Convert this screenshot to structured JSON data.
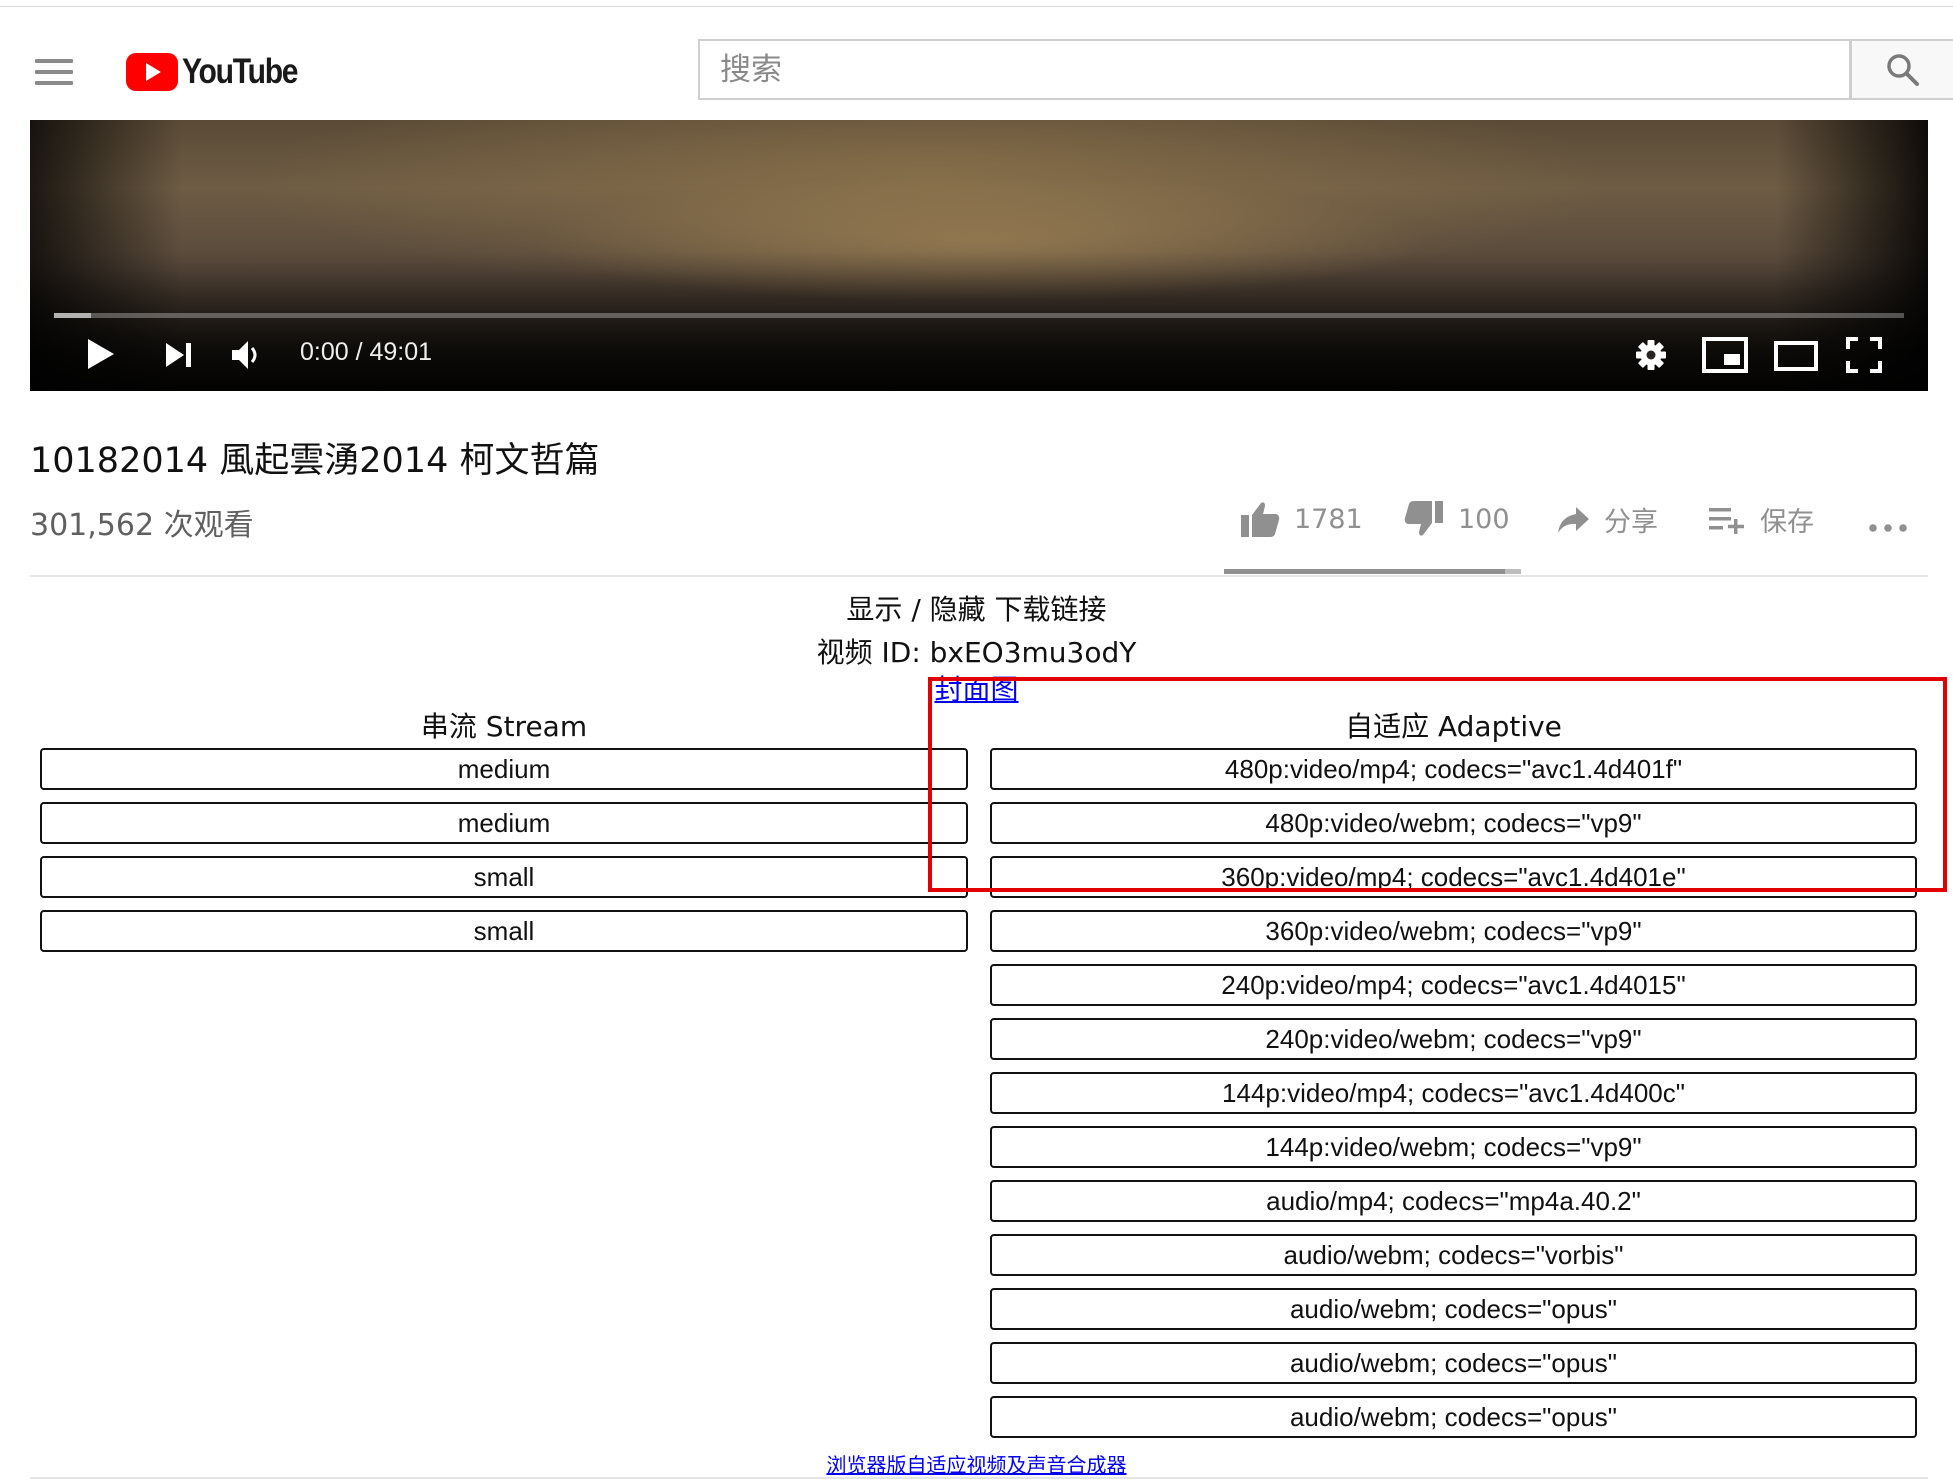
{
  "header": {
    "logo_text": "YouTube",
    "search_placeholder": "搜索"
  },
  "player": {
    "time": "0:00 / 49:01",
    "loaded_fraction": 0.02
  },
  "video": {
    "title": "10182014 風起雲湧2014 柯文哲篇",
    "views": "301,562 次观看",
    "likes": "1781",
    "dislikes": "100",
    "share_label": "分享",
    "save_label": "保存",
    "like_ratio": 0.947
  },
  "downloader": {
    "toggle_label": "显示 / 隐藏 下载链接",
    "video_id_line": "视频 ID: bxEO3mu3odY",
    "cover_link": "封面图",
    "stream_header": "串流 Stream",
    "adaptive_header": "自适应 Adaptive",
    "stream": [
      "medium",
      "medium",
      "small",
      "small"
    ],
    "adaptive": [
      "480p:video/mp4; codecs=\"avc1.4d401f\"",
      "480p:video/webm; codecs=\"vp9\"",
      "360p:video/mp4; codecs=\"avc1.4d401e\"",
      "360p:video/webm; codecs=\"vp9\"",
      "240p:video/mp4; codecs=\"avc1.4d4015\"",
      "240p:video/webm; codecs=\"vp9\"",
      "144p:video/mp4; codecs=\"avc1.4d400c\"",
      "144p:video/webm; codecs=\"vp9\"",
      "audio/mp4; codecs=\"mp4a.40.2\"",
      "audio/webm; codecs=\"vorbis\"",
      "audio/webm; codecs=\"opus\"",
      "audio/webm; codecs=\"opus\"",
      "audio/webm; codecs=\"opus\""
    ],
    "footer_link": "浏览器版自适应视频及声音合成器"
  },
  "colors": {
    "highlight": "#e00000",
    "link": "#0000ee",
    "brand_red": "#ff0000"
  }
}
